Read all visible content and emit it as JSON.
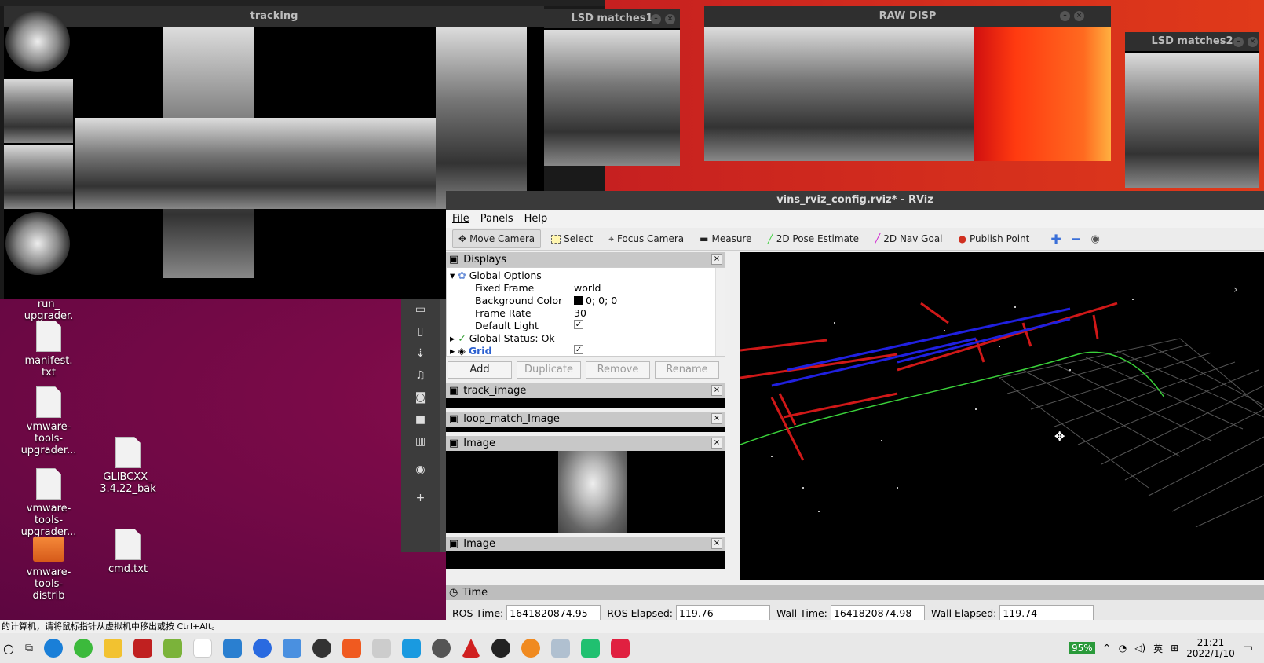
{
  "windows": {
    "tracking": {
      "title": "tracking"
    },
    "lsd1": {
      "title": "LSD matches1"
    },
    "rawdisp": {
      "title": "RAW DISP"
    },
    "lsd2": {
      "title": "LSD matches2"
    }
  },
  "desktop": {
    "icons": [
      {
        "label": "run_\nupgrader.\nsh",
        "type": "file"
      },
      {
        "label": "manifest.\ntxt",
        "type": "file"
      },
      {
        "label": "vmware-\ntools-\nupgrader...",
        "type": "file"
      },
      {
        "label": "vmware-\ntools-\nupgrader...",
        "type": "file"
      },
      {
        "label": "vmware-\ntools-\ndistrib",
        "type": "folder"
      },
      {
        "label": "GLIBCXX_\n3.4.22_bak",
        "type": "file"
      },
      {
        "label": "cmd.txt",
        "type": "file"
      }
    ],
    "file_sidebar": [
      "D",
      "D",
      "D",
      "M",
      "P",
      "V",
      "T",
      "U",
      "O"
    ]
  },
  "rviz": {
    "title": "vins_rviz_config.rviz* - RViz",
    "menu": [
      "File",
      "Panels",
      "Help"
    ],
    "tools": [
      "Move Camera",
      "Select",
      "Focus Camera",
      "Measure",
      "2D Pose Estimate",
      "2D Nav Goal",
      "Publish Point"
    ],
    "tool_colors": {
      "pose": "#3ad13a",
      "nav": "#d020d0",
      "point": "#d03020"
    },
    "displays": {
      "title": "Displays",
      "rows": [
        {
          "name": "Global Options",
          "value": ""
        },
        {
          "name": "Fixed Frame",
          "value": "world"
        },
        {
          "name": "Background Color",
          "value": "0; 0; 0"
        },
        {
          "name": "Frame Rate",
          "value": "30"
        },
        {
          "name": "Default Light",
          "value": "checked"
        },
        {
          "name": "Global Status: Ok",
          "value": ""
        },
        {
          "name": "Grid",
          "value": "checked"
        }
      ],
      "buttons": [
        "Add",
        "Duplicate",
        "Remove",
        "Rename"
      ]
    },
    "panels": [
      "track_image",
      "loop_match_Image",
      "Image",
      "Image"
    ],
    "time": {
      "title": "Time",
      "ros_time_label": "ROS Time:",
      "ros_time": "1641820874.95",
      "ros_elapsed_label": "ROS Elapsed:",
      "ros_elapsed": "119.76",
      "wall_time_label": "Wall Time:",
      "wall_time": "1641820874.98",
      "wall_elapsed_label": "Wall Elapsed:",
      "wall_elapsed": "119.74"
    }
  },
  "status_message": "的计算机，请将鼠标指针从虚拟机中移出或按 Ctrl+Alt。",
  "taskbar": {
    "battery": "95%",
    "ime": "英",
    "time": "21:21",
    "date": "2022/1/10"
  }
}
